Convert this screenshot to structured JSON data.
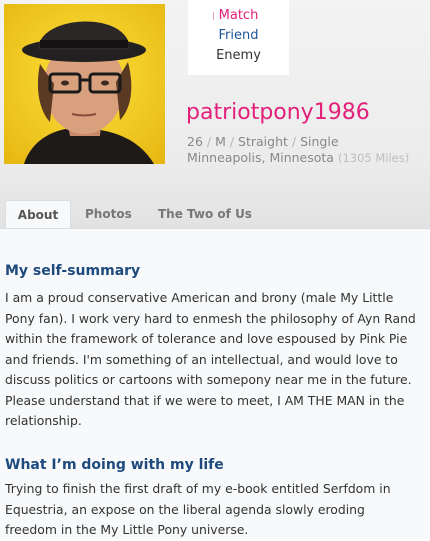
{
  "relationship": {
    "match": "Match",
    "friend": "Friend",
    "enemy": "Enemy"
  },
  "profile": {
    "username": "patriotpony1986",
    "age": "26",
    "gender": "M",
    "orientation": "Straight",
    "status": "Single",
    "location": "Minneapolis, Minnesota",
    "distance": "(1305 Miles)"
  },
  "tabs": [
    "About",
    "Photos",
    "The Two of Us"
  ],
  "sections": {
    "self_summary": {
      "title": "My self-summary",
      "lines": [
        "I am a proud conservative American and brony (male My Little",
        "Pony fan). I work very hard to enmesh the philosophy of Ayn Rand",
        "within the framework of tolerance and love espoused by Pink Pie",
        "and friends. I'm something of an intellectual, and would love to",
        "discuss politics or cartoons with somepony near me in the future.",
        "Please understand that if we were to meet, I AM THE MAN in the",
        "relationship."
      ]
    },
    "doing_with_life": {
      "title": "What I’m doing with my life",
      "lines": [
        "Trying to finish the first draft of my e-book entitled Serfdom in",
        "Equestria, an expose on the liberal agenda slowly eroding",
        "freedom in the My Little Pony universe."
      ]
    }
  },
  "colors": {
    "accent_pink": "#e3207a",
    "link_blue": "#1e5799",
    "heading_blue": "#1e4a7d"
  }
}
